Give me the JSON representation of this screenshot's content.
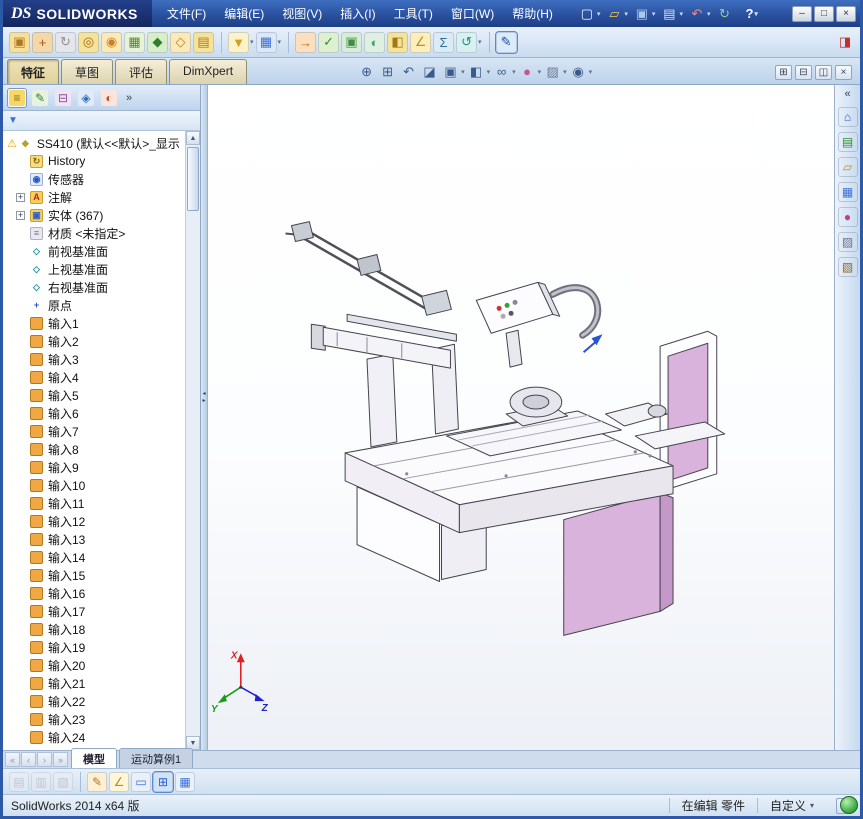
{
  "titlebar": {
    "brand_ds": "DS",
    "brand_name": "SOLIDWORKS",
    "menus": [
      {
        "label": "文件(F)"
      },
      {
        "label": "编辑(E)"
      },
      {
        "label": "视图(V)"
      },
      {
        "label": "插入(I)"
      },
      {
        "label": "工具(T)"
      },
      {
        "label": "窗口(W)"
      },
      {
        "label": "帮助(H)"
      }
    ],
    "quick_icons": [
      {
        "name": "new-document-icon",
        "glyph": "▢",
        "fg": "#f0f4fc",
        "caret": true
      },
      {
        "name": "open-icon",
        "glyph": "▱",
        "fg": "#f5c84c",
        "caret": true
      },
      {
        "name": "save-icon",
        "glyph": "▣",
        "fg": "#a8c8f0",
        "caret": true
      },
      {
        "name": "print-icon",
        "glyph": "▤",
        "fg": "#d8e0f0",
        "caret": true
      },
      {
        "name": "undo-icon",
        "glyph": "↶",
        "fg": "#f08a8a",
        "caret": true
      },
      {
        "name": "rebuild-icon",
        "glyph": "↻",
        "fg": "#8fd08f",
        "caret": false
      }
    ],
    "help_icon": {
      "glyph": "?"
    },
    "window_buttons": [
      {
        "name": "minimize-window-icon",
        "glyph": "–"
      },
      {
        "name": "maximize-window-icon",
        "glyph": "□"
      },
      {
        "name": "close-window-icon",
        "glyph": "×"
      }
    ]
  },
  "toolbar2": {
    "icons": [
      {
        "name": "edit-sketch-icon",
        "glyph": "▣",
        "fg": "#b07818",
        "bg": "#f6e09a"
      },
      {
        "name": "move-component-icon",
        "glyph": "+",
        "fg": "#c05010",
        "bg": "#f3d9a8"
      },
      {
        "name": "rotate-component-icon",
        "glyph": "↻",
        "fg": "#909098",
        "bg": "#e6e6ea"
      },
      {
        "name": "alert-icon",
        "glyph": "◎",
        "fg": "#a06a10",
        "bg": "#f6e39a"
      },
      {
        "name": "mate-icon",
        "glyph": "◉",
        "fg": "#d08020",
        "bg": "#fbe9b8"
      },
      {
        "name": "pattern-icon",
        "glyph": "▦",
        "fg": "#4a8a20",
        "bg": "#e8f2d8"
      },
      {
        "name": "fastener-icon",
        "glyph": "◆",
        "fg": "#2f7f2f",
        "bg": "#d8eec8"
      },
      {
        "name": "reference-geometry-icon",
        "glyph": "◇",
        "fg": "#c08020",
        "bg": "#fbe9b8"
      },
      {
        "name": "bom-icon",
        "glyph": "▤",
        "fg": "#b07818",
        "bg": "#f6e39a"
      },
      {
        "name": "selection-filter-icon",
        "glyph": "▼",
        "fg": "#d0a020",
        "bg": "#fdf3c8",
        "caret": true,
        "cls": "grp"
      },
      {
        "name": "grid-system-icon",
        "glyph": "▦",
        "fg": "#3a6fd8",
        "bg": "#dce8f8",
        "caret": true
      },
      {
        "name": "export-icon",
        "glyph": "→",
        "fg": "#d06810",
        "bg": "#fbe0c0",
        "cls": "grp"
      },
      {
        "name": "verify-icon",
        "glyph": "✓",
        "fg": "#2f8f2f",
        "bg": "#def0d0"
      },
      {
        "name": "instant3d-icon",
        "glyph": "▣",
        "fg": "#3f8f3f",
        "bg": "#d8ecd8"
      },
      {
        "name": "shaded-display-icon",
        "glyph": "◐",
        "fg": "#3f9f6f",
        "bg": "#e0f0e0"
      },
      {
        "name": "section-tool-icon",
        "glyph": "◧",
        "fg": "#a07818",
        "bg": "#f6e39a"
      },
      {
        "name": "measure-icon",
        "glyph": "∠",
        "fg": "#c09020",
        "bg": "#fdeebc"
      },
      {
        "name": "equations-icon",
        "glyph": "Σ",
        "fg": "#2f6f9f",
        "bg": "#dceaf4"
      },
      {
        "name": "refresh-icon",
        "glyph": "↺",
        "fg": "#1f8f8f",
        "bg": "#d8f0ee",
        "caret": true
      },
      {
        "name": "sketch-pen-icon",
        "glyph": "✎",
        "fg": "#205090",
        "bg": "#cfe0f4",
        "active": true,
        "cls": "grp"
      }
    ],
    "options_icon": {
      "glyph": "◨"
    }
  },
  "ribbon": {
    "tabs": [
      {
        "label": "特征",
        "active": true
      },
      {
        "label": "草图"
      },
      {
        "label": "评估"
      },
      {
        "label": "DimXpert"
      }
    ],
    "hud_icons": [
      {
        "name": "zoom-fit-icon",
        "glyph": "⊕",
        "fg": "#3a5a8a"
      },
      {
        "name": "zoom-area-icon",
        "glyph": "⊞",
        "fg": "#3a5a8a"
      },
      {
        "name": "previous-view-icon",
        "glyph": "↶",
        "fg": "#3a5a8a"
      },
      {
        "name": "section-view-icon",
        "glyph": "◪",
        "fg": "#3a5a8a"
      },
      {
        "name": "view-orientation-icon",
        "glyph": "▣",
        "fg": "#3a5a8a",
        "caret": true
      },
      {
        "name": "display-style-icon",
        "glyph": "◧",
        "fg": "#3a5a8a",
        "caret": true
      },
      {
        "name": "hide-show-items-icon",
        "glyph": "∞",
        "fg": "#3a5a8a",
        "caret": true
      },
      {
        "name": "edit-appearance-icon",
        "glyph": "●",
        "fg": "#c05890",
        "caret": true
      },
      {
        "name": "apply-scene-icon",
        "glyph": "▨",
        "fg": "#6a7a9a",
        "caret": true
      },
      {
        "name": "view-settings-icon",
        "glyph": "◉",
        "fg": "#3a5a8a",
        "caret": true
      }
    ],
    "window_icons": [
      {
        "name": "tile-windows-icon",
        "glyph": "⊞"
      },
      {
        "name": "cascade-windows-icon",
        "glyph": "⊟"
      },
      {
        "name": "split-view-icon",
        "glyph": "◫"
      },
      {
        "name": "close-document-icon",
        "glyph": "×"
      }
    ]
  },
  "feature_panel": {
    "header_icons": [
      {
        "name": "featuremanager-tab-icon",
        "glyph": "≡",
        "fg": "#8a6a10",
        "bg": "#f7d766",
        "active": true
      },
      {
        "name": "propertymanager-tab-icon",
        "glyph": "✎",
        "fg": "#2f7f2f",
        "bg": "#e8f2e0"
      },
      {
        "name": "configurationmanager-tab-icon",
        "glyph": "⊟",
        "fg": "#8f4fa0",
        "bg": "#f0e4f4"
      },
      {
        "name": "dimxpertmanager-tab-icon",
        "glyph": "◈",
        "fg": "#2f6fbf",
        "bg": "#e0eaf8"
      },
      {
        "name": "displaymanager-tab-icon",
        "glyph": "◐",
        "fg": "#c05030",
        "bg": "#fae4dc"
      }
    ],
    "overflow_glyph": "»",
    "filter_icon": {
      "glyph": "▼"
    },
    "scroll_up_glyph": "▲",
    "scroll_down_glyph": "▼",
    "tree_items": [
      {
        "label": "SS410 (默认<<默认>_显示",
        "glyph": "◆",
        "iconFg": "#b8a020",
        "iconBg": "transparent",
        "warn": true,
        "cls": "root"
      },
      {
        "label": "History",
        "glyph": "↻",
        "iconFg": "#8a6a10",
        "iconBg": "#f7dc82",
        "iconBorder": "#c8a030"
      },
      {
        "label": "传感器",
        "glyph": "◉",
        "iconFg": "#2255cc",
        "iconBg": "#e4ecfa",
        "iconBorder": "#9ab0d8"
      },
      {
        "label": "注解",
        "glyph": "A",
        "iconFg": "#c02020",
        "iconBg": "#f7cf5a",
        "iconBorder": "#c8a030",
        "plus": true
      },
      {
        "label": "实体 (367)",
        "glyph": "▣",
        "iconFg": "#2a5fd4",
        "iconBg": "#f7cf5a",
        "iconBorder": "#c8a030",
        "plus": true
      },
      {
        "label": "材质 <未指定>",
        "glyph": "≡",
        "iconFg": "#777788",
        "iconBg": "#e8e8f0",
        "iconBorder": "#b0b0c0"
      },
      {
        "label": "前视基准面",
        "glyph": "◇",
        "iconFg": "#1f8f9f",
        "iconBg": "transparent"
      },
      {
        "label": "上视基准面",
        "glyph": "◇",
        "iconFg": "#1f8f9f",
        "iconBg": "transparent"
      },
      {
        "label": "右视基准面",
        "glyph": "◇",
        "iconFg": "#1f8f9f",
        "iconBg": "transparent"
      },
      {
        "label": "原点",
        "glyph": "+",
        "iconFg": "#2255cc",
        "iconBg": "transparent"
      },
      {
        "label": "输入1",
        "glyph": "",
        "iconFg": "#7a4a00",
        "iconBg": "#f0a845",
        "iconBorder": "#b87818"
      },
      {
        "label": "输入2",
        "glyph": "",
        "iconFg": "#7a4a00",
        "iconBg": "#f0a845",
        "iconBorder": "#b87818"
      },
      {
        "label": "输入3",
        "glyph": "",
        "iconFg": "#7a4a00",
        "iconBg": "#f0a845",
        "iconBorder": "#b87818"
      },
      {
        "label": "输入4",
        "glyph": "",
        "iconFg": "#7a4a00",
        "iconBg": "#f0a845",
        "iconBorder": "#b87818"
      },
      {
        "label": "输入5",
        "glyph": "",
        "iconFg": "#7a4a00",
        "iconBg": "#f0a845",
        "iconBorder": "#b87818"
      },
      {
        "label": "输入6",
        "glyph": "",
        "iconFg": "#7a4a00",
        "iconBg": "#f0a845",
        "iconBorder": "#b87818"
      },
      {
        "label": "输入7",
        "glyph": "",
        "iconFg": "#7a4a00",
        "iconBg": "#f0a845",
        "iconBorder": "#b87818"
      },
      {
        "label": "输入8",
        "glyph": "",
        "iconFg": "#7a4a00",
        "iconBg": "#f0a845",
        "iconBorder": "#b87818"
      },
      {
        "label": "输入9",
        "glyph": "",
        "iconFg": "#7a4a00",
        "iconBg": "#f0a845",
        "iconBorder": "#b87818"
      },
      {
        "label": "输入10",
        "glyph": "",
        "iconFg": "#7a4a00",
        "iconBg": "#f0a845",
        "iconBorder": "#b87818"
      },
      {
        "label": "输入11",
        "glyph": "",
        "iconFg": "#7a4a00",
        "iconBg": "#f0a845",
        "iconBorder": "#b87818"
      },
      {
        "label": "输入12",
        "glyph": "",
        "iconFg": "#7a4a00",
        "iconBg": "#f0a845",
        "iconBorder": "#b87818"
      },
      {
        "label": "输入13",
        "glyph": "",
        "iconFg": "#7a4a00",
        "iconBg": "#f0a845",
        "iconBorder": "#b87818"
      },
      {
        "label": "输入14",
        "glyph": "",
        "iconFg": "#7a4a00",
        "iconBg": "#f0a845",
        "iconBorder": "#b87818"
      },
      {
        "label": "输入15",
        "glyph": "",
        "iconFg": "#7a4a00",
        "iconBg": "#f0a845",
        "iconBorder": "#b87818"
      },
      {
        "label": "输入16",
        "glyph": "",
        "iconFg": "#7a4a00",
        "iconBg": "#f0a845",
        "iconBorder": "#b87818"
      },
      {
        "label": "输入17",
        "glyph": "",
        "iconFg": "#7a4a00",
        "iconBg": "#f0a845",
        "iconBorder": "#b87818"
      },
      {
        "label": "输入18",
        "glyph": "",
        "iconFg": "#7a4a00",
        "iconBg": "#f0a845",
        "iconBorder": "#b87818"
      },
      {
        "label": "输入19",
        "glyph": "",
        "iconFg": "#7a4a00",
        "iconBg": "#f0a845",
        "iconBorder": "#b87818"
      },
      {
        "label": "输入20",
        "glyph": "",
        "iconFg": "#7a4a00",
        "iconBg": "#f0a845",
        "iconBorder": "#b87818"
      },
      {
        "label": "输入21",
        "glyph": "",
        "iconFg": "#7a4a00",
        "iconBg": "#f0a845",
        "iconBorder": "#b87818"
      },
      {
        "label": "输入22",
        "glyph": "",
        "iconFg": "#7a4a00",
        "iconBg": "#f0a845",
        "iconBorder": "#b87818"
      },
      {
        "label": "输入23",
        "glyph": "",
        "iconFg": "#7a4a00",
        "iconBg": "#f0a845",
        "iconBorder": "#b87818"
      },
      {
        "label": "输入24",
        "glyph": "",
        "iconFg": "#7a4a00",
        "iconBg": "#f0a845",
        "iconBorder": "#b87818"
      }
    ]
  },
  "viewport": {
    "triad": {
      "x": "X",
      "y": "Y",
      "z": "Z"
    },
    "splitter_left_glyph": "◂",
    "splitter_right_glyph": "▸"
  },
  "task_pane": {
    "collapse_glyph": "«",
    "icons": [
      {
        "name": "resources-home-icon",
        "glyph": "⌂",
        "fg": "#2a5fd4",
        "bg": "#e8f0fa"
      },
      {
        "name": "design-library-icon",
        "glyph": "▤",
        "fg": "#2f8f2f",
        "bg": "#def0d8"
      },
      {
        "name": "file-explorer-icon",
        "glyph": "▱",
        "fg": "#c09020",
        "bg": "#faeec8"
      },
      {
        "name": "view-palette-icon",
        "glyph": "▦",
        "fg": "#3a6fd8",
        "bg": "#dce8f8"
      },
      {
        "name": "appearances-icon",
        "glyph": "●",
        "fg": "#c04080",
        "bg": "#f4dcec"
      },
      {
        "name": "scenes-icon",
        "glyph": "▨",
        "fg": "#6f6f8f",
        "bg": "#e8e8f0"
      },
      {
        "name": "custom-properties-icon",
        "glyph": "▧",
        "fg": "#8a6a30",
        "bg": "#f0e8d8"
      }
    ]
  },
  "bottom_tabs": {
    "nav": [
      {
        "name": "first-tab-icon",
        "glyph": "«"
      },
      {
        "name": "previous-tab-icon",
        "glyph": "‹"
      },
      {
        "name": "next-tab-icon",
        "glyph": "›"
      },
      {
        "name": "last-tab-icon",
        "glyph": "»"
      }
    ],
    "tabs": [
      {
        "label": "模型",
        "active": true
      },
      {
        "label": "运动算例1"
      }
    ]
  },
  "bottom_toolbar": {
    "icons": [
      {
        "name": "stamp-note-icon",
        "glyph": "▤",
        "fg": "#a8acb8",
        "bg": "#e8ecf2",
        "cls": "disabled"
      },
      {
        "name": "stamp-balloon-icon",
        "glyph": "▥",
        "fg": "#a8acb8",
        "bg": "#e8ecf2",
        "cls": "disabled"
      },
      {
        "name": "stamp-weld-icon",
        "glyph": "▧",
        "fg": "#a8acb8",
        "bg": "#e8ecf2",
        "cls": "disabled"
      },
      {
        "name": "annotation-pen-icon",
        "glyph": "✎",
        "fg": "#c07020",
        "bg": "#fdf0d4",
        "cls": "grp"
      },
      {
        "name": "smart-dimension-icon",
        "glyph": "∠",
        "fg": "#b89018",
        "bg": "#fdf6d8"
      },
      {
        "name": "single-view-icon",
        "glyph": "▭",
        "fg": "#3a6fd8",
        "bg": "#e8f0fa"
      },
      {
        "name": "four-view-icon",
        "glyph": "⊞",
        "fg": "#2a5fd4",
        "bg": "#cfe2f8",
        "active": true
      },
      {
        "name": "drawing-table-icon",
        "glyph": "▦",
        "fg": "#3a6fd8",
        "bg": "#e8f0fa"
      }
    ]
  },
  "status_bar": {
    "app_version": "SolidWorks 2014 x64 版",
    "editing_status": "在编辑 零件",
    "custom_label": "自定义",
    "custom_caret": "▾",
    "help_glyph": "?"
  }
}
